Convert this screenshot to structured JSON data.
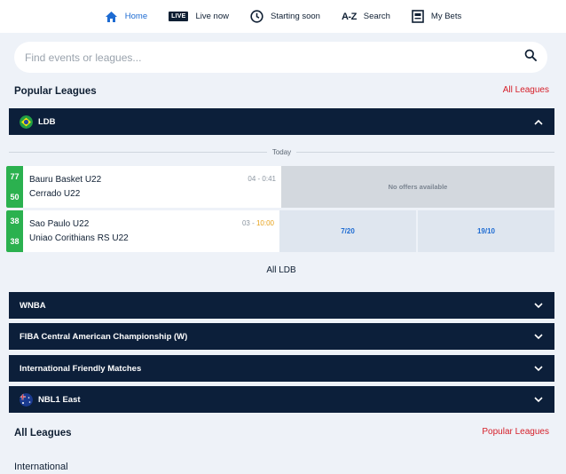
{
  "nav": {
    "items": [
      {
        "label": "Home",
        "icon": "home-icon",
        "active": true
      },
      {
        "label": "Live now",
        "icon": "live-badge-icon",
        "badge": "LIVE"
      },
      {
        "label": "Starting soon",
        "icon": "clock-icon"
      },
      {
        "label": "Search",
        "icon": "az-icon",
        "badge": "A-Z"
      },
      {
        "label": "My Bets",
        "icon": "betslip-icon"
      }
    ]
  },
  "search": {
    "placeholder": "Find events or leagues..."
  },
  "popular": {
    "title": "Popular Leagues",
    "link": "All Leagues"
  },
  "ldb": {
    "name": "LDB",
    "day": "Today",
    "events": [
      {
        "home": "Bauru Basket U22",
        "away": "Cerrado U22",
        "home_score": "77",
        "away_score": "50",
        "period": "04",
        "sep": " - ",
        "clock": "0:41",
        "offers": "No offers available"
      },
      {
        "home": "Sao Paulo U22",
        "away": "Uniao Corithians RS U22",
        "home_score": "38",
        "away_score": "38",
        "period": "03",
        "sep": " - ",
        "clock": "10:00",
        "odds": [
          "7/20",
          "19/10"
        ]
      }
    ],
    "all_link": "All LDB"
  },
  "leagues": [
    {
      "name": "WNBA"
    },
    {
      "name": "FIBA Central American Championship (W)"
    },
    {
      "name": "International Friendly Matches"
    },
    {
      "name": "NBL1 East"
    }
  ],
  "all_leagues": {
    "title": "All Leagues",
    "link": "Popular Leagues",
    "first_group": "International"
  },
  "colors": {
    "accent": "#1d6bd2",
    "dark_bar": "#0c1f3a",
    "live_green": "#2bb14f",
    "link_red": "#d6202a",
    "clock_amber": "#e7a21b"
  }
}
